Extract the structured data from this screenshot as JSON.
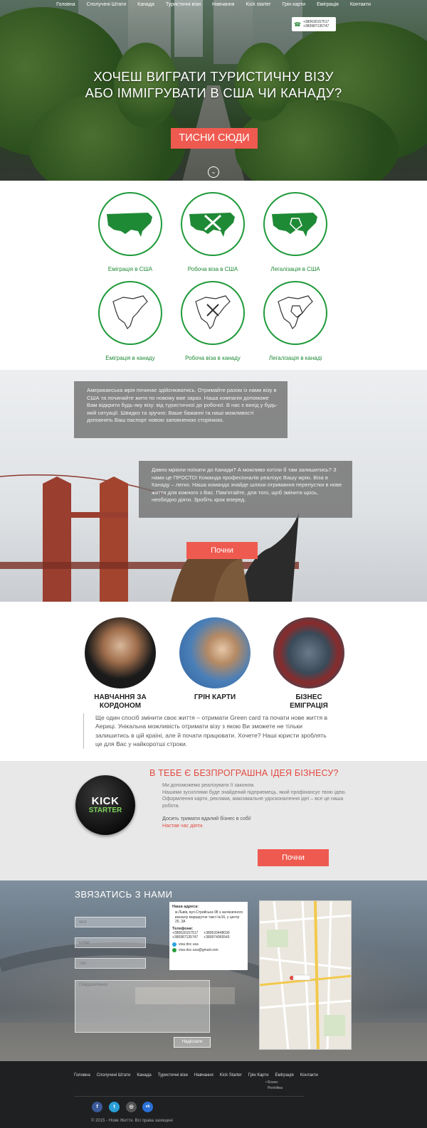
{
  "nav": {
    "items": [
      "Головна",
      "Сполучені Штати",
      "Канада",
      "Туристичні візи",
      "Навчання",
      "Kick starter",
      "Грін карти",
      "Еміграція",
      "Контакти"
    ]
  },
  "hero": {
    "phones": [
      "+380630157517",
      "+380987135747"
    ],
    "title_line1": "ХОЧЕШ ВИГРАТИ ТУРИСТИЧНУ ВІЗУ",
    "title_line2": "АБО ІММІГРУВАТИ В США ЧИ КАНАДУ?",
    "button": "ТИСНИ СЮДИ"
  },
  "services": [
    {
      "label": "Еміграція в США"
    },
    {
      "label": "Робоча віза в США"
    },
    {
      "label": "Легалізація в США"
    },
    {
      "label": "Еміграція в канаду"
    },
    {
      "label": "Робоча віза в канаду"
    },
    {
      "label": "Легалізація в канаді"
    }
  ],
  "bridge": {
    "text1": "Американська мрія починає здійснюватись. Отримайте разом із нами візу в США та починайте жити по новому вже зараз. Наша компанія допоможе Вам відкрити будь-яку візу: від туристичної до робочої. В нас є вихід у будь-якій ситуації. Швидко та зручно: Ваше бажанні та наші можливості доповнять Ваш паспорт новою заповненою сторінкою.",
    "text2": "Давно мріяли поїхати до Канади? А можливо хотіли б там залишитись? З нами це ПРОСТО! Команда професіоналів реалізує Вашу мрію. Віза в Канаду – легко. Наша команда знайде шляхи отримання перепустки в нове життя для кожного з Вас. Пам'ятайте, для того, щоб змінити щось, необхідно діяти.  Зробіть крок вперед.",
    "button": "Почни"
  },
  "features": {
    "items": [
      {
        "title_l1": "НАВЧАННЯ ЗА",
        "title_l2": "КОРДОНОМ"
      },
      {
        "title_l1": "ГРІН КАРТИ",
        "title_l2": ""
      },
      {
        "title_l1": "БІЗНЕС",
        "title_l2": "ЕМІГРАЦІЯ"
      }
    ],
    "text": "Ще один спосіб змінити своє життя – отримати Green card та почати нове життя в Аериці. Унікальна можливість отримати візу з якою Ви зможете не тільки залишитись в цій країні, але й почати працювати. Хочете? Наші юристи зроблять це для Вас у найкоротші строки."
  },
  "kickstarter": {
    "logo_line1": "KICK",
    "logo_line2": "STARTER",
    "title": "В ТЕБЕ Є БЕЗПРОГРАШНА ІДЕЯ БІЗНЕСУ?",
    "body_l1": "Ми допоможемо реалізувати її законом.",
    "body_l2": "Нашими зусиллями буде знайдений підприємець, який профінансує твою ідею. Оформлення карти, реклама, максимальне удосконалення ідеї – все це наша робота.",
    "sub": "Досить тримати вдалий бізнес в собі!",
    "cta": "Настав час діяти.",
    "button": "Почни"
  },
  "contact": {
    "title": "ЗВЯЗАТИСЬ З НАМИ",
    "name_ph": "Ім'я",
    "email_ph": "Email",
    "tel_ph": "Тел",
    "message_ph": "Повідомлення",
    "send": "Надіслати",
    "address_h": "Наша адреса:",
    "address": "м.Львів, вул.Стрийська 98 з залізничного вокзалу маршрутне таксі №16, у центр 25, 3А",
    "phones_h": "Телефони:",
    "phones": [
      "+380630157517",
      "+380633448030",
      "+380987135747",
      "+380974065543"
    ],
    "skype": "visa doc usa",
    "email": "visa doc.usa@gmail.com"
  },
  "footer": {
    "nav": [
      "Головна",
      "Сполучені Штати",
      "Канада",
      "Туристичні візи",
      "Навчання",
      "Kick Starter",
      "Грін Карти",
      "Еміграція",
      "Контакти"
    ],
    "sub1": "• Бізнес",
    "sub2": "Релігійна",
    "social": [
      "f",
      "t",
      "◎",
      "vk"
    ],
    "copyright": "© 2015 - Нове Життя. Всі права захищені"
  },
  "colors": {
    "accent": "#ef5a50",
    "green": "#1f9a3a",
    "footer": "#1e2022"
  }
}
